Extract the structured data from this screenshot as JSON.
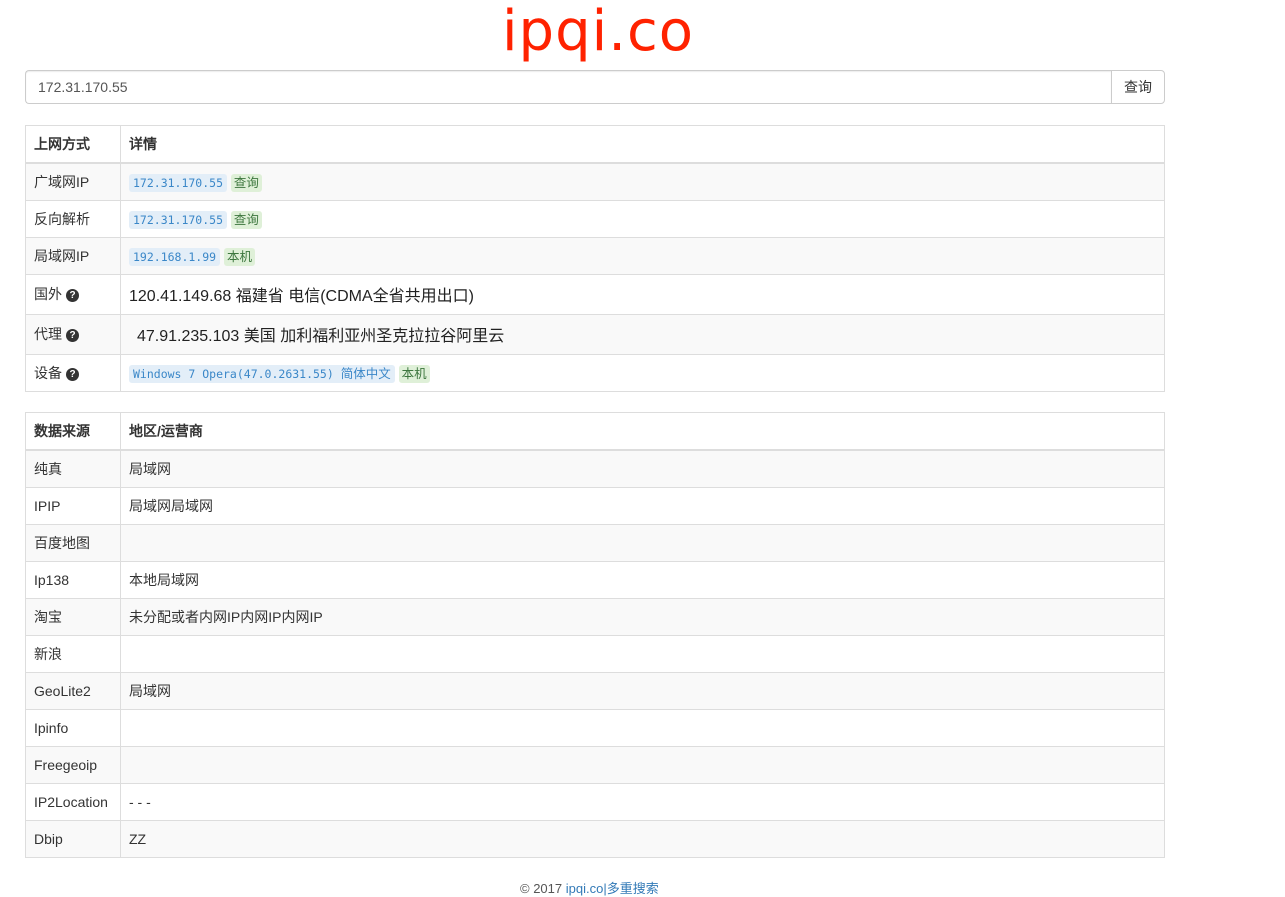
{
  "logo": "ipqi.co",
  "search": {
    "value": "172.31.170.55",
    "button_label": "查询"
  },
  "net_table": {
    "headers": [
      "上网方式",
      "详情"
    ],
    "wan": {
      "label": "广域网IP",
      "ip": "172.31.170.55",
      "action": "查询"
    },
    "reverse": {
      "label": "反向解析",
      "ip": "172.31.170.55",
      "action": "查询"
    },
    "lan": {
      "label": "局域网IP",
      "ip": "192.168.1.99",
      "tag": "本机"
    },
    "foreign": {
      "label": "国外",
      "value": "120.41.149.68 福建省 电信(CDMA全省共用出口)"
    },
    "proxy": {
      "label": "代理",
      "value": "47.91.235.103 美国 加利福利亚州圣克拉拉谷阿里云"
    },
    "device": {
      "label": "设备",
      "ua": "Windows 7 Opera(47.0.2631.55)",
      "lang": "简体中文",
      "tag": "本机"
    }
  },
  "source_table": {
    "headers": [
      "数据来源",
      "地区/运营商"
    ],
    "rows": [
      {
        "source": "纯真",
        "region": "局域网"
      },
      {
        "source": "IPIP",
        "region": "局域网局域网"
      },
      {
        "source": "百度地图",
        "region": ""
      },
      {
        "source": "Ip138",
        "region": "本地局域网"
      },
      {
        "source": "淘宝",
        "region": "未分配或者内网IP内网IP内网IP"
      },
      {
        "source": "新浪",
        "region": ""
      },
      {
        "source": "GeoLite2",
        "region": "局域网"
      },
      {
        "source": "Ipinfo",
        "region": ""
      },
      {
        "source": "Freegeoip",
        "region": ""
      },
      {
        "source": "IP2Location",
        "region": "- - -"
      },
      {
        "source": "Dbip",
        "region": "ZZ"
      }
    ]
  },
  "footer": {
    "copyright": "© 2017 ",
    "link": "ipqi.co|多重搜索"
  },
  "colors": {
    "logo": "#ff2200",
    "link": "#337ab7",
    "code_bg": "#e3eef8",
    "tag_green_bg": "#dff0d8"
  }
}
